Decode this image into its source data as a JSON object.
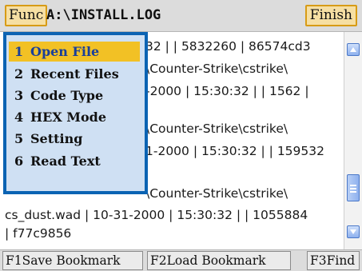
{
  "titlebar": {
    "func_label": "Func",
    "title": "A:\\INSTALL.LOG",
    "finish_label": "Finish"
  },
  "content": {
    "lines": [
      "32 | | 5832260 | 86574cd3",
      "\\Counter-Strike\\cstrike\\",
      "-2000 | 15:30:32 | | 1562 |",
      "\\Counter-Strike\\cstrike\\",
      "1-2000 | 15:30:32 | | 159532",
      "\\Counter-Strike\\cstrike\\",
      "cs_dust.wad | 10-31-2000 | 15:30:32 | | 1055884",
      " | f77c9856"
    ]
  },
  "menu": {
    "items": [
      {
        "num": "1",
        "label": "Open File",
        "selected": true
      },
      {
        "num": "2",
        "label": "Recent Files",
        "selected": false
      },
      {
        "num": "3",
        "label": "Code Type",
        "selected": false
      },
      {
        "num": "4",
        "label": "HEX Mode",
        "selected": false
      },
      {
        "num": "5",
        "label": "Setting",
        "selected": false
      },
      {
        "num": "6",
        "label": "Read Text",
        "selected": false
      }
    ]
  },
  "bottombar": {
    "f1_label": "F1Save Bookmark",
    "f2_label": "F2Load Bookmark",
    "f3_label": "F3Find"
  },
  "icons": {
    "scroll_up": "arrow-up-icon",
    "scroll_down": "arrow-down-icon"
  },
  "colors": {
    "button_fill": "#f6dfa3",
    "button_border": "#d79b16",
    "menu_border": "#0b63b3",
    "menu_bg": "#cfe0f3",
    "menu_highlight": "#f2c125",
    "scrollbar_accent": "#4b78c8"
  }
}
